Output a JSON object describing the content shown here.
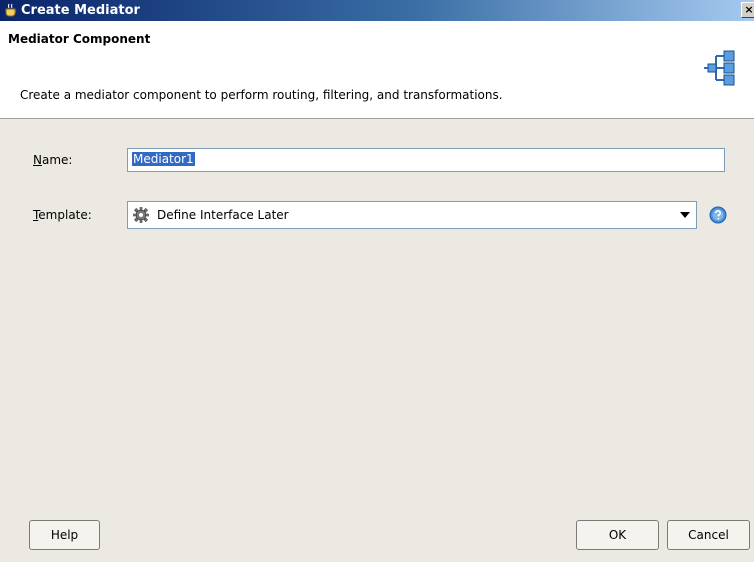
{
  "window": {
    "title": "Create Mediator",
    "app_icon": "jdeveloper-cup-icon",
    "close_icon": "close-icon"
  },
  "header": {
    "title": "Mediator Component",
    "description": "Create a mediator component to perform routing, filtering, and transformations.",
    "icon": "mediator-tree-icon"
  },
  "form": {
    "name": {
      "label": "Name:",
      "accesskey": "N",
      "value": "Mediator1"
    },
    "template": {
      "label": "Template:",
      "accesskey": "T",
      "value": "Define Interface Later",
      "icon": "gear-icon"
    }
  },
  "buttons": {
    "help": "Help",
    "ok": "OK",
    "cancel": "Cancel"
  },
  "colors": {
    "title_bar": "#0a246a",
    "selection": "#316ac5",
    "field_border": "#7f9db9",
    "dialog_bg": "#ece9e2"
  }
}
